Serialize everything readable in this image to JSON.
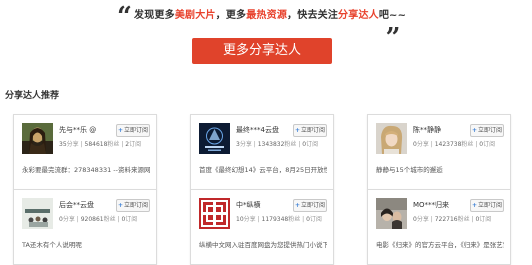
{
  "promo": {
    "open_quote": "“",
    "close_quote": "„",
    "slogan_p1": "发现更多",
    "slogan_h1": "美剧大片",
    "slogan_p2": "，更多",
    "slogan_h2": "最热资源",
    "slogan_p3": "，快去关注",
    "slogan_h3": "分享达人",
    "slogan_p4": "吧~~",
    "button_label": "更多分享达人",
    "highlight_color": "#e8412c",
    "button_color": "#e0432b"
  },
  "section_title": "分享达人推荐",
  "follow_label": "立即订阅",
  "share_unit": "分享",
  "fans_unit": "粉丝",
  "sub_unit": "订阅",
  "cards": [
    {
      "name": "先与**乐 @",
      "shares": "35",
      "fans": "584618",
      "subs": "2",
      "desc": "永彩要最完流群：278348331 --资料来源网络，",
      "avatar": "mona-lisa-painting"
    },
    {
      "name": "最终***4云盘",
      "shares": "3",
      "fans": "1343832",
      "subs": "0",
      "desc": "首度《最终幻想14》云平台，8月25日开放性测",
      "avatar": "final-fantasy-logo"
    },
    {
      "name": "陈**静静",
      "shares": "0",
      "fans": "1423738",
      "subs": "0",
      "desc": "静静与15个城市的邂逅",
      "avatar": "woman-portrait"
    },
    {
      "name": "后会**云盘",
      "shares": "0",
      "fans": "920861",
      "subs": "0",
      "desc": "TA还木有个人说明呢",
      "avatar": "movie-poster"
    },
    {
      "name": "中*纵横",
      "shares": "10",
      "fans": "1179348",
      "subs": "0",
      "desc": "纵横中文网入驻百度网盘为您提供热门小说下载，",
      "avatar": "zongheng-logo"
    },
    {
      "name": "MO***归来",
      "shares": "0",
      "fans": "722716",
      "subs": "0",
      "desc": "电影《归来》的官方云平台，《归来》是张艺谋、",
      "avatar": "coming-home-poster"
    }
  ]
}
